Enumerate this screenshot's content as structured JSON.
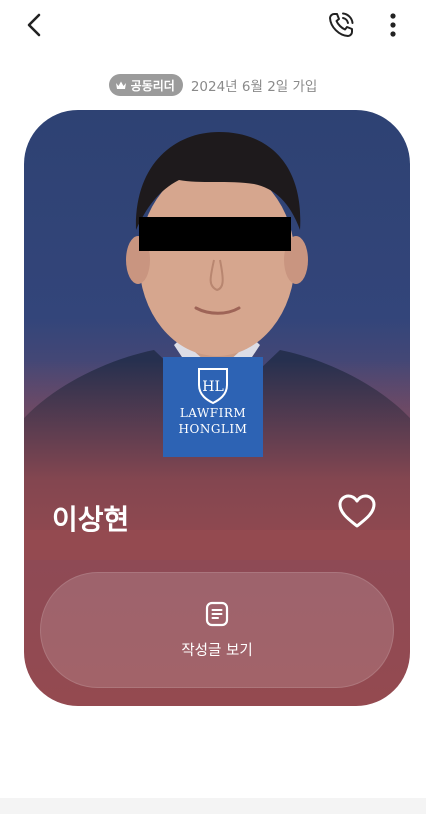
{
  "header": {
    "back_icon": "chevron-left-icon",
    "call_icon": "phone-call-icon",
    "more_icon": "more-vertical-icon"
  },
  "member": {
    "role_badge": "공동리더",
    "role_icon": "crown-icon",
    "join_date": "2024년 6월 2일 가입",
    "name": "이상현",
    "logo_monogram": "HL",
    "logo_line1": "LAWFIRM",
    "logo_line2": "HONGLIM"
  },
  "actions": {
    "like_icon": "heart-icon",
    "posts_icon": "document-icon",
    "posts_label": "작성글 보기"
  },
  "colors": {
    "card_top": "#2e4273",
    "card_bottom": "#944a50",
    "logo_bg": "#2d63b4",
    "badge_bg": "#9b9b9b"
  }
}
